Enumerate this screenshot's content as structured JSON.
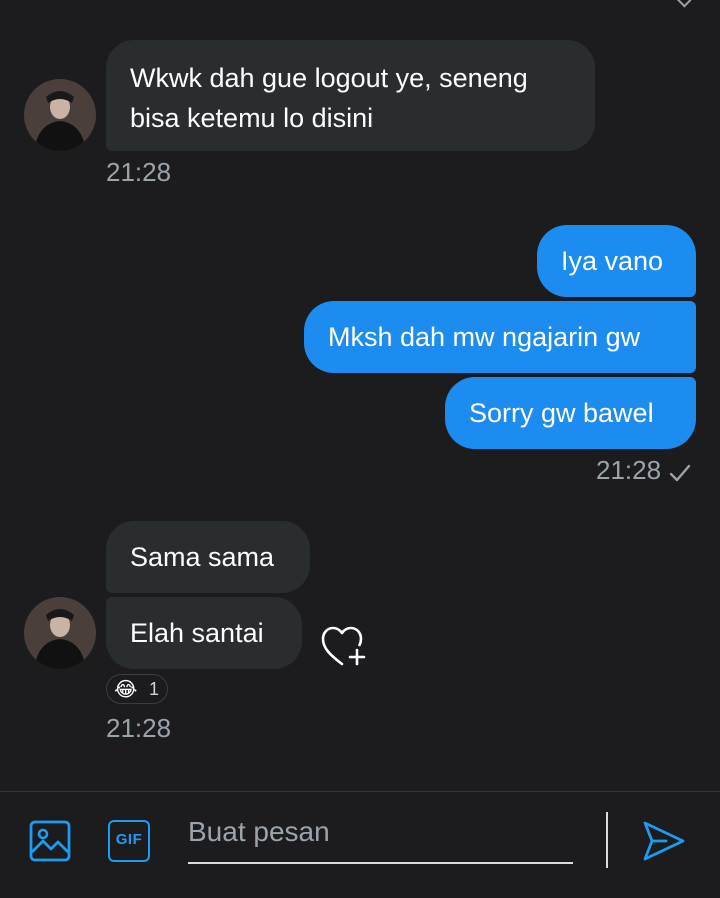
{
  "messages": {
    "incoming_1": {
      "line1": "Wkwk dah gue logout ye, seneng",
      "line2": "bisa ketemu lo disini",
      "time": "21:28"
    },
    "outgoing": {
      "bubble1": "Iya vano",
      "bubble2": "Mksh dah mw ngajarin gw",
      "bubble3": "Sorry gw bawel",
      "time": "21:28"
    },
    "incoming_2": {
      "bubble1": "Sama sama",
      "bubble2": "Elah santai",
      "reaction_emoji": "😂",
      "reaction_count": "1",
      "time": "21:28"
    }
  },
  "composer": {
    "placeholder": "Buat pesan",
    "gif_label": "GIF"
  },
  "colors": {
    "background": "#1c1c1e",
    "incoming_bubble": "#2a2d30",
    "outgoing_bubble": "#1d8cf0",
    "accent": "#1d9bf0",
    "muted_text": "#9ba3ab"
  },
  "icons": {
    "image": "image-icon",
    "gif": "gif-icon",
    "send": "send-icon",
    "heart_add": "heart-add-icon",
    "read": "checkmark-icon"
  }
}
